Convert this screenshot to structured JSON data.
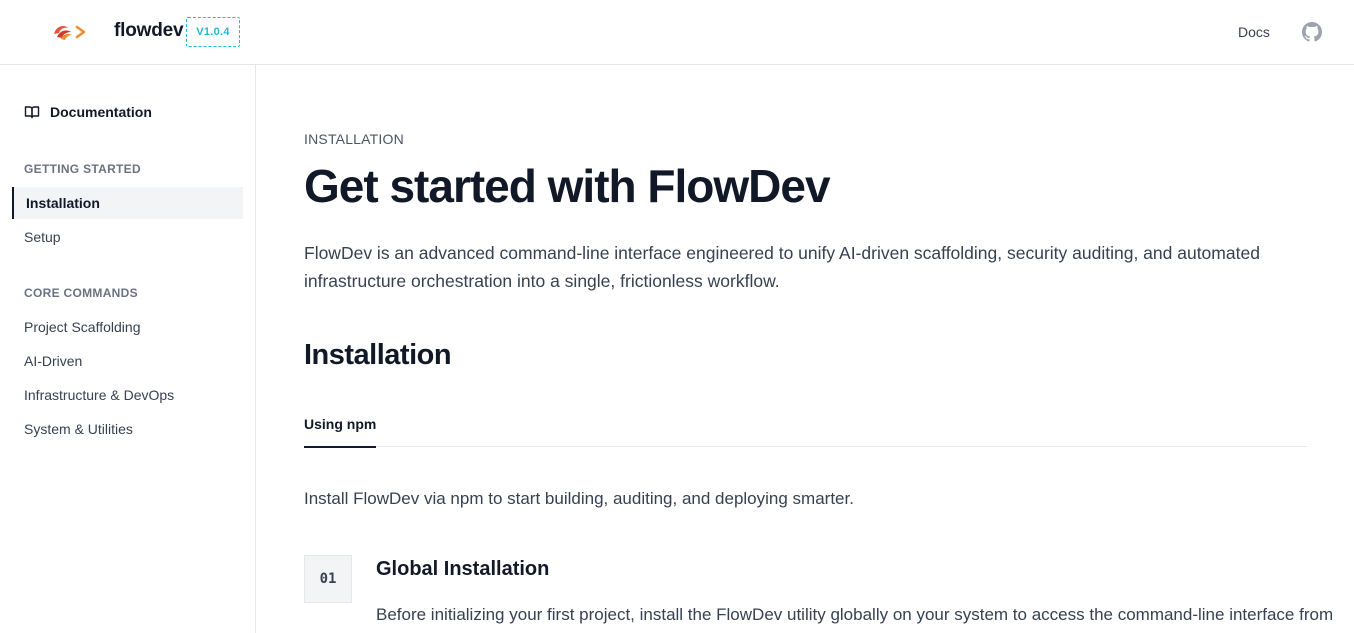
{
  "header": {
    "brand": "flowdev",
    "version": "V1.0.4",
    "docs_link": "Docs",
    "github_icon": "github-icon",
    "logo_icon": "flowdev-logo-icon"
  },
  "sidebar": {
    "heading": "Documentation",
    "heading_icon": "book-open-icon",
    "sections": [
      {
        "title": "GETTING STARTED",
        "items": [
          {
            "label": "Installation",
            "active": true
          },
          {
            "label": "Setup",
            "active": false
          }
        ]
      },
      {
        "title": "CORE COMMANDS",
        "items": [
          {
            "label": "Project Scaffolding",
            "active": false
          },
          {
            "label": "AI-Driven",
            "active": false
          },
          {
            "label": "Infrastructure & DevOps",
            "active": false
          },
          {
            "label": "System & Utilities",
            "active": false
          }
        ]
      }
    ]
  },
  "main": {
    "eyebrow": "INSTALLATION",
    "title": "Get started with FlowDev",
    "lead": "FlowDev is an advanced command-line interface engineered to unify AI-driven scaffolding, security auditing, and automated infrastructure orchestration into a single, frictionless workflow.",
    "section_title": "Installation",
    "tabs": [
      {
        "label": "Using npm",
        "active": true
      }
    ],
    "intro": "Install FlowDev via npm to start building, auditing, and deploying smarter.",
    "steps": [
      {
        "number": "01",
        "title": "Global Installation",
        "description": "Before initializing your first project, install the FlowDev utility globally on your system to access the command-line interface from"
      }
    ]
  },
  "colors": {
    "accent": "#22b8d6",
    "logo_primary": "#e5533d",
    "logo_secondary": "#f28b30",
    "text_primary": "#111827",
    "text_secondary": "#374151",
    "border": "#e5e7eb"
  }
}
